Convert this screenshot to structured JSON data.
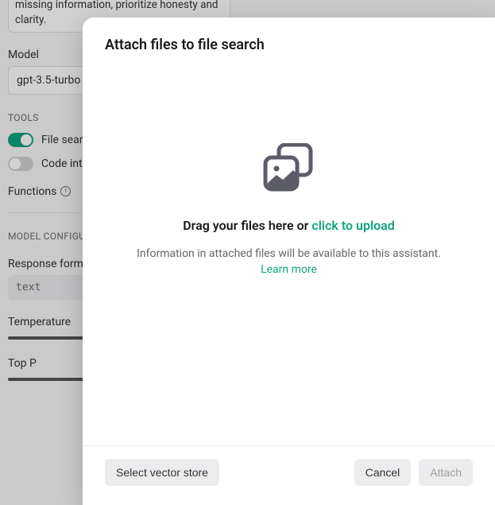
{
  "background": {
    "instructions_text": "based on the information given. If a question cannot be answered due to missing information, prioritize honesty and clarity.",
    "model_label": "Model",
    "model_value": "gpt-3.5-turbo",
    "tools_header": "TOOLS",
    "file_search_label": "File search",
    "code_interpreter_label": "Code interpreter",
    "functions_label": "Functions",
    "model_config_header": "MODEL CONFIGURATION",
    "response_format_label": "Response format",
    "response_format_value": "text",
    "temperature_label": "Temperature",
    "top_p_label": "Top P"
  },
  "modal": {
    "title": "Attach files to file search",
    "drop_prompt_prefix": "Drag your files here or ",
    "drop_prompt_link": "click to upload",
    "info_text": "Information in attached files will be available to this assistant.",
    "learn_more": "Learn more",
    "select_vector_store": "Select vector store",
    "cancel": "Cancel",
    "attach": "Attach"
  }
}
